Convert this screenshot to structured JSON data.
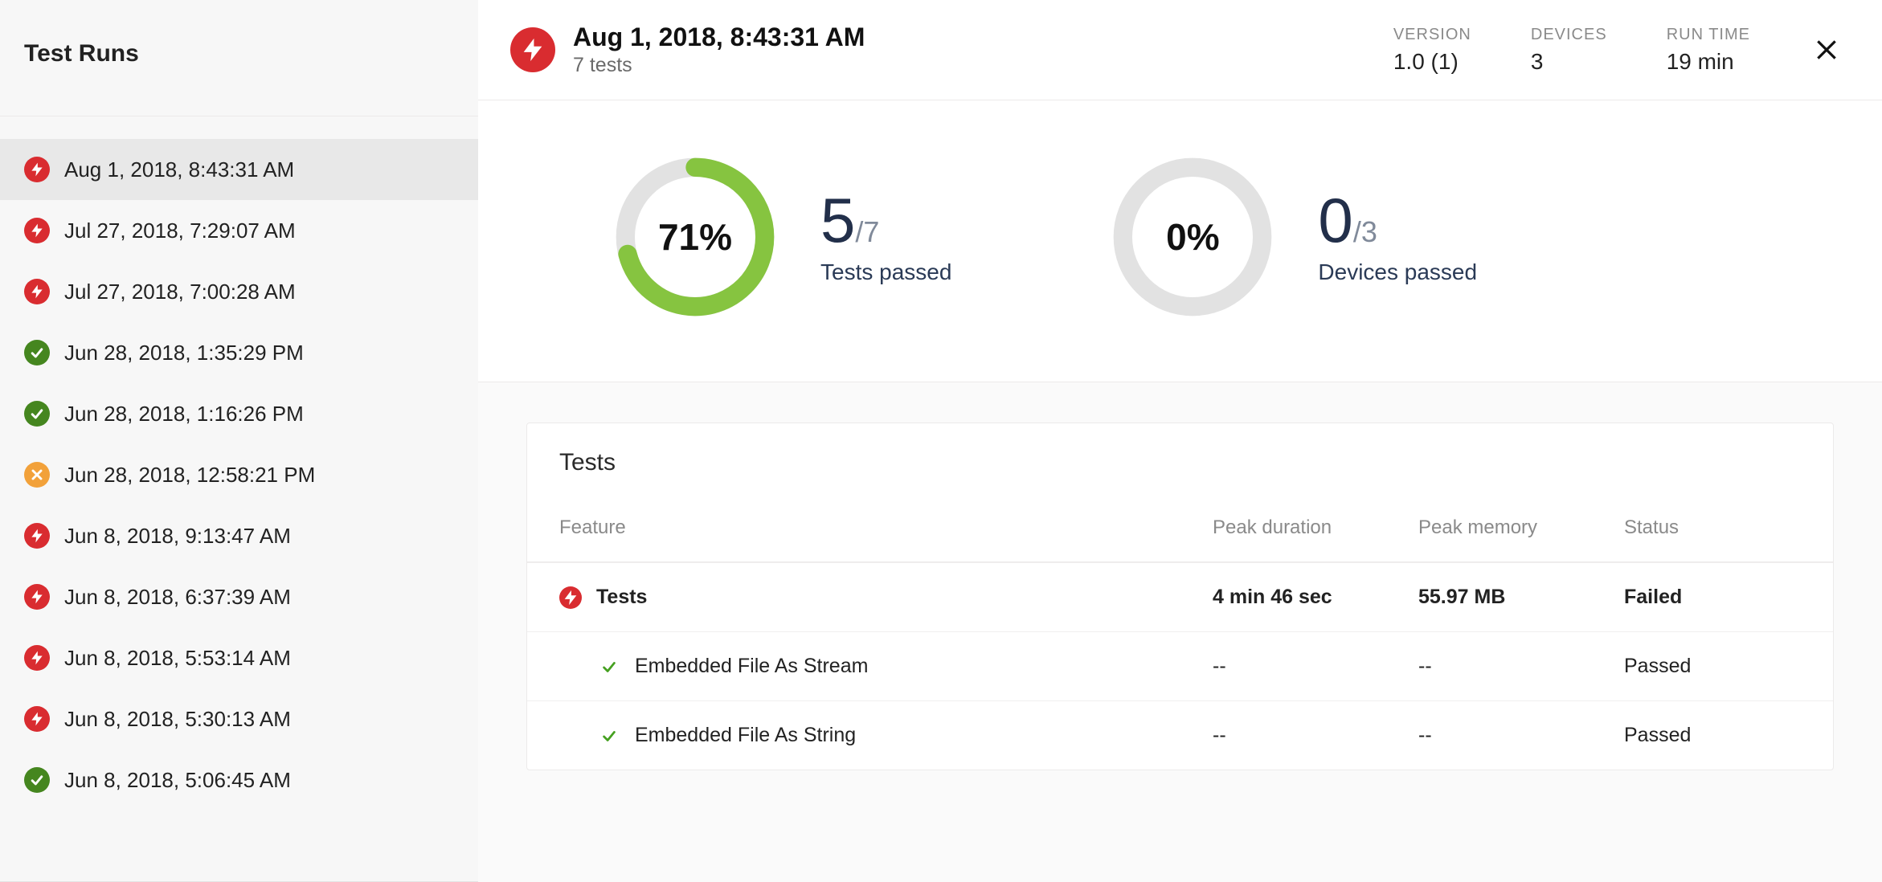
{
  "sidebar": {
    "title": "Test Runs",
    "runs": [
      {
        "label": "Aug 1, 2018, 8:43:31 AM",
        "status": "fail",
        "selected": true
      },
      {
        "label": "Jul 27, 2018, 7:29:07 AM",
        "status": "fail",
        "selected": false
      },
      {
        "label": "Jul 27, 2018, 7:00:28 AM",
        "status": "fail",
        "selected": false
      },
      {
        "label": "Jun 28, 2018, 1:35:29 PM",
        "status": "pass",
        "selected": false
      },
      {
        "label": "Jun 28, 2018, 1:16:26 PM",
        "status": "pass",
        "selected": false
      },
      {
        "label": "Jun 28, 2018, 12:58:21 PM",
        "status": "warn",
        "selected": false
      },
      {
        "label": "Jun 8, 2018, 9:13:47 AM",
        "status": "fail",
        "selected": false
      },
      {
        "label": "Jun 8, 2018, 6:37:39 AM",
        "status": "fail",
        "selected": false
      },
      {
        "label": "Jun 8, 2018, 5:53:14 AM",
        "status": "fail",
        "selected": false
      },
      {
        "label": "Jun 8, 2018, 5:30:13 AM",
        "status": "fail",
        "selected": false
      },
      {
        "label": "Jun 8, 2018, 5:06:45 AM",
        "status": "pass",
        "selected": false
      }
    ]
  },
  "header": {
    "title": "Aug 1, 2018, 8:43:31 AM",
    "subtitle": "7 tests",
    "status": "fail",
    "stats": {
      "version_label": "VERSION",
      "version_value": "1.0 (1)",
      "devices_label": "DEVICES",
      "devices_value": "3",
      "runtime_label": "RUN TIME",
      "runtime_value": "19 min"
    }
  },
  "summary": {
    "tests": {
      "percent": 71,
      "percent_text": "71%",
      "numerator": "5",
      "denominator": "/7",
      "caption": "Tests passed",
      "color": "#86c440"
    },
    "devices": {
      "percent": 0,
      "percent_text": "0%",
      "numerator": "0",
      "denominator": "/3",
      "caption": "Devices passed",
      "color": "#e2e2e2"
    }
  },
  "tests_card": {
    "title": "Tests",
    "columns": {
      "feature": "Feature",
      "peak_duration": "Peak duration",
      "peak_memory": "Peak memory",
      "status": "Status"
    },
    "rows": [
      {
        "icon": "fail",
        "indent": 0,
        "feature": "Tests",
        "peak_duration": "4 min 46 sec",
        "peak_memory": "55.97 MB",
        "status": "Failed",
        "bold": true
      },
      {
        "icon": "check",
        "indent": 1,
        "feature": "Embedded File As Stream",
        "peak_duration": "--",
        "peak_memory": "--",
        "status": "Passed",
        "bold": false
      },
      {
        "icon": "check",
        "indent": 1,
        "feature": "Embedded File As String",
        "peak_duration": "--",
        "peak_memory": "--",
        "status": "Passed",
        "bold": false
      }
    ]
  }
}
